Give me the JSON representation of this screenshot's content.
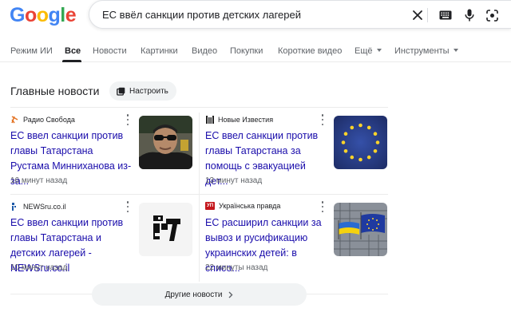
{
  "logo": {
    "letters": [
      "G",
      "o",
      "o",
      "g",
      "l",
      "e"
    ],
    "colors": [
      "#4285f4",
      "#ea4335",
      "#fbbc05",
      "#4285f4",
      "#34a853",
      "#ea4335"
    ]
  },
  "search": {
    "query": "ЕС ввёл санкции против детских лагерей"
  },
  "tabs": [
    {
      "label": "Режим ИИ"
    },
    {
      "label": "Все",
      "active": true
    },
    {
      "label": "Новости"
    },
    {
      "label": "Картинки"
    },
    {
      "label": "Видео"
    },
    {
      "label": "Покупки"
    },
    {
      "label": "Короткие видео"
    },
    {
      "label": "Ещё",
      "dropdown": true
    },
    {
      "label": "Инструменты",
      "dropdown": true
    }
  ],
  "news": {
    "title": "Главные новости",
    "customize_label": "Настроить",
    "more_label": "Другие новости",
    "cards": [
      {
        "source": "Радио Свобода",
        "headline": "ЕС ввел санкции против главы Татарстана Рустама Минниханова из-за...",
        "time": "16 минут назад"
      },
      {
        "source": "Новые Известия",
        "headline": "ЕС ввел санкции против главы Татарстана за помощь с эвакуацией дет...",
        "time": "13 минут назад"
      },
      {
        "source": "NEWSru.co.il",
        "headline": "ЕС ввел санкции против главы Татарстана и детских лагерей - NEWSru.co.il",
        "time": "10 минут назад"
      },
      {
        "source": "Українська правда",
        "source_badge": "УП",
        "headline": "ЕС расширил санкции за вывоз и русификацию украинских детей: в списо...",
        "time": "22 минуты назад"
      }
    ]
  },
  "colors": {
    "link": "#1a0dab",
    "muted": "#5f6368",
    "eu_blue": "#2b3f8f",
    "eu_star": "#ffd42a"
  }
}
